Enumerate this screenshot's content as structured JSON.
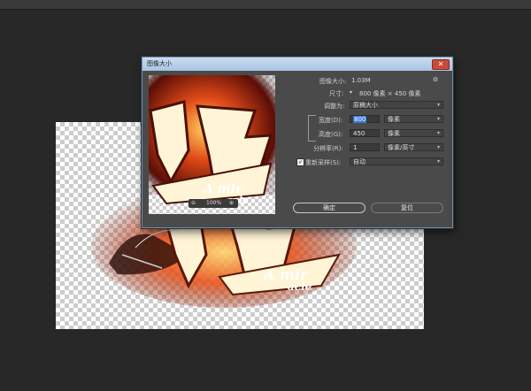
{
  "dialog": {
    "title": "图像大小",
    "close_label": "✕",
    "image_size_label": "图像大小:",
    "image_size_value": "1.03M",
    "dimensions_label": "尺寸:",
    "dimensions_value": "800 像素 × 450 像素",
    "fit_to_label": "调整为:",
    "fit_to_value": "原稿大小",
    "width_label": "宽度(D):",
    "width_value": "800",
    "width_unit": "像素",
    "height_label": "高度(G):",
    "height_value": "450",
    "height_unit": "像素",
    "resolution_label": "分辨率(R):",
    "resolution_value": "1",
    "resolution_unit": "像素/英寸",
    "resample_label": "重新采样(S):",
    "resample_checked": "✓",
    "resample_value": "自动",
    "ok_label": "确定",
    "reset_label": "复位",
    "zoom_value": "100%"
  },
  "icons": {
    "gear": "gear-icon",
    "zoom_out": "zoom-out-icon",
    "zoom_in": "zoom-in-icon",
    "link": "chain-link-icon"
  },
  "colors": {
    "titlebar": "#b9d1ec",
    "close": "#c94a3b",
    "selection": "#3b78d8",
    "flame": "#e0471c"
  }
}
